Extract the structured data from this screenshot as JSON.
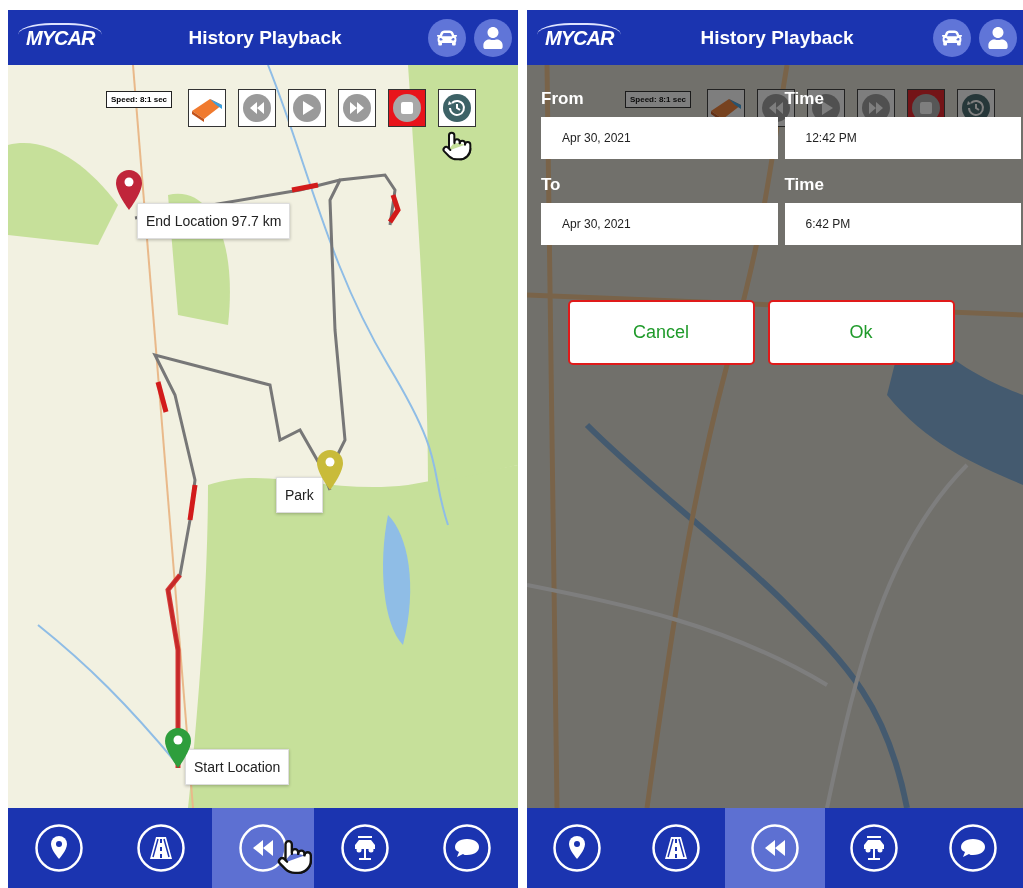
{
  "screens": [
    {
      "logo": "MYCAR",
      "title": "History Playback",
      "toolbar": {
        "speed": "Speed: 8:1 sec",
        "buttons": [
          {
            "kind": "eraser",
            "pointer": false
          },
          {
            "kind": "rewind",
            "pointer": false
          },
          {
            "kind": "play",
            "pointer": false
          },
          {
            "kind": "forward",
            "pointer": false
          },
          {
            "kind": "stop",
            "pointer": false
          },
          {
            "kind": "history",
            "pointer": true
          }
        ]
      },
      "map": {
        "kind": "rural",
        "markers": [
          {
            "kind": "end",
            "color": "#c0253a",
            "label": "End Location 97.7 km"
          },
          {
            "kind": "park",
            "color": "#c9bb3a",
            "label": "Park"
          },
          {
            "kind": "start",
            "color": "#2e9e3c",
            "label": "Start Location"
          }
        ]
      },
      "nav": [
        {
          "kind": "pin",
          "selected": false,
          "pointer": false
        },
        {
          "kind": "road",
          "selected": false,
          "pointer": false
        },
        {
          "kind": "rewind",
          "selected": true,
          "pointer": true
        },
        {
          "kind": "lift",
          "selected": false,
          "pointer": false
        },
        {
          "kind": "chat",
          "selected": false,
          "pointer": false
        }
      ]
    },
    {
      "logo": "MYCAR",
      "title": "History Playback",
      "toolbar": {
        "speed": "Speed: 8:1 sec",
        "buttons": [
          {
            "kind": "eraser",
            "pointer": false
          },
          {
            "kind": "rewind",
            "pointer": false
          },
          {
            "kind": "play",
            "pointer": false
          },
          {
            "kind": "forward",
            "pointer": false
          },
          {
            "kind": "stop",
            "pointer": false
          },
          {
            "kind": "history",
            "pointer": false
          }
        ]
      },
      "map": {
        "kind": "city"
      },
      "dialog": {
        "rows": [
          {
            "date_label": "From",
            "date": "Apr 30, 2021",
            "time_label": "Time",
            "time": "12:42 PM"
          },
          {
            "date_label": "To",
            "date": "Apr 30, 2021",
            "time_label": "Time",
            "time": "6:42 PM"
          }
        ],
        "buttons": [
          "Cancel",
          "Ok"
        ]
      },
      "nav": [
        {
          "kind": "pin",
          "selected": false,
          "pointer": false
        },
        {
          "kind": "road",
          "selected": false,
          "pointer": false
        },
        {
          "kind": "rewind",
          "selected": true,
          "pointer": false
        },
        {
          "kind": "lift",
          "selected": false,
          "pointer": false
        },
        {
          "kind": "chat",
          "selected": false,
          "pointer": false
        }
      ]
    }
  ]
}
